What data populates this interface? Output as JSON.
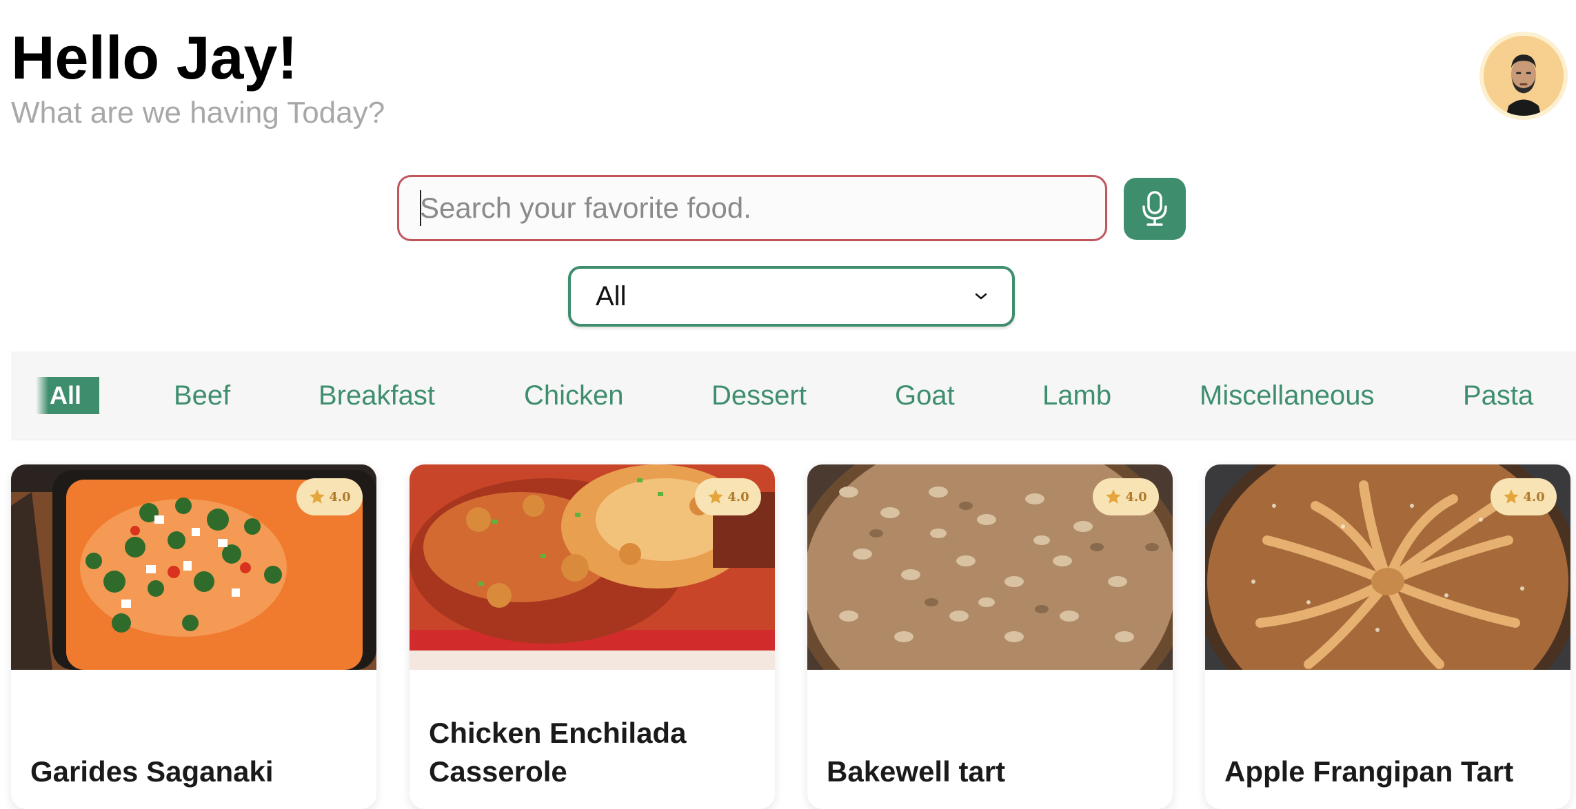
{
  "header": {
    "greeting": "Hello Jay!",
    "subtitle": "What are we having Today?",
    "avatar_icon": "user-avatar-icon"
  },
  "search": {
    "placeholder": "Search your favorite food.",
    "value": "",
    "mic_icon": "microphone-icon"
  },
  "filter": {
    "selected": "All"
  },
  "categories": {
    "active": "All",
    "items": [
      "All",
      "Beef",
      "Breakfast",
      "Chicken",
      "Dessert",
      "Goat",
      "Lamb",
      "Miscellaneous",
      "Pasta"
    ]
  },
  "recipes": [
    {
      "title": "Garides Saganaki",
      "rating": "4.0"
    },
    {
      "title": "Chicken Enchilada Casserole",
      "rating": "4.0"
    },
    {
      "title": "Bakewell tart",
      "rating": "4.0"
    },
    {
      "title": "Apple Frangipan Tart",
      "rating": "4.0"
    }
  ],
  "colors": {
    "accent": "#3e8e6e",
    "search_border": "#c0565d",
    "rating_bg": "#f8e3b5",
    "rating_text": "#b07a2a"
  }
}
